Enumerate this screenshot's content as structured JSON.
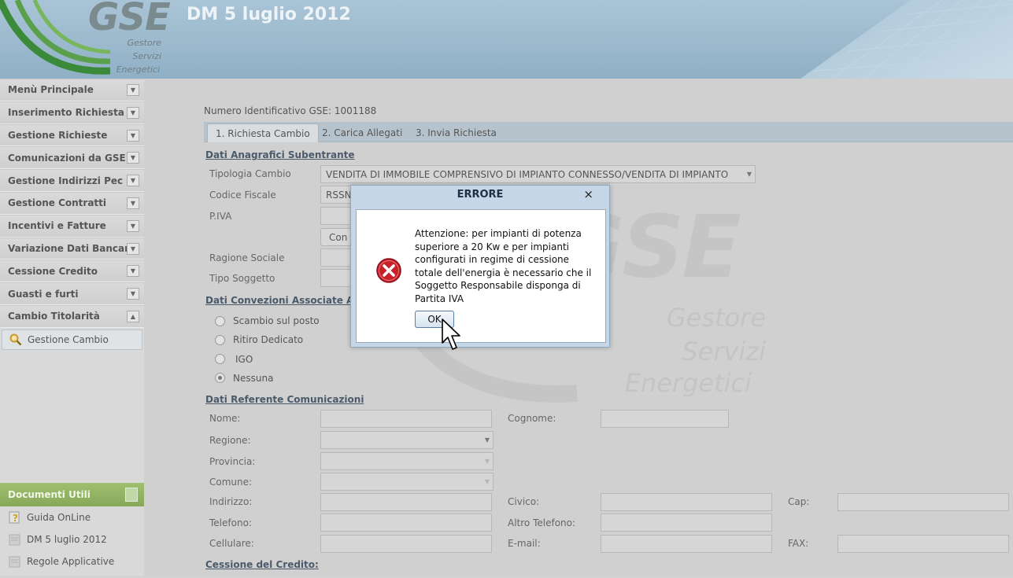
{
  "header": {
    "logo_text": "GSE",
    "logo_lines": [
      "Gestore",
      "Servizi",
      "Energetici"
    ],
    "app_title": "DM 5 luglio 2012"
  },
  "sidebar": {
    "items": [
      {
        "label": "Menù Principale",
        "toggle": "▼"
      },
      {
        "label": "Inserimento Richiesta",
        "toggle": "▼"
      },
      {
        "label": "Gestione Richieste",
        "toggle": "▼"
      },
      {
        "label": "Comunicazioni da GSE",
        "toggle": "▼"
      },
      {
        "label": "Gestione Indirizzi Pec",
        "toggle": "▼"
      },
      {
        "label": "Gestione Contratti",
        "toggle": "▼"
      },
      {
        "label": "Incentivi e Fatture",
        "toggle": "▼"
      },
      {
        "label": "Variazione Dati Bancari",
        "toggle": "▼"
      },
      {
        "label": "Cessione Credito",
        "toggle": "▼"
      },
      {
        "label": "Guasti e furti",
        "toggle": "▼"
      },
      {
        "label": "Cambio Titolarità",
        "toggle": "▲"
      }
    ],
    "subitem": {
      "label": "Gestione Cambio",
      "icon": "search-icon"
    },
    "documents": {
      "header": "Documenti Utili",
      "items": [
        {
          "label": "Guida OnLine",
          "icon": "help-document-icon"
        },
        {
          "label": "DM 5 luglio 2012",
          "icon": "document-icon"
        },
        {
          "label": "Regole Applicative",
          "icon": "document-icon"
        }
      ]
    }
  },
  "main": {
    "watermark": {
      "text": "GSE",
      "lines": [
        "Gestore",
        "Servizi",
        "Energetici"
      ]
    },
    "gse_id": "Numero Identificativo GSE: 1001188",
    "tabs": [
      "1. Richiesta Cambio",
      "2. Carica Allegati",
      "3. Invia Richiesta"
    ],
    "section_anagrafici": "Dati Anagrafici Subentrante",
    "tipologia_label": "Tipologia Cambio",
    "tipologia_value": "VENDITA DI IMMOBILE COMPRENSIVO DI IMPIANTO CONNESSO/VENDITA DI IMPIANTO",
    "codice_fiscale_label": "Codice Fiscale",
    "codice_fiscale_value": "RSSN",
    "piva_label": "P.IVA",
    "control_button": "Con",
    "ragione_sociale_label": "Ragione Sociale",
    "tipo_soggetto_label": "Tipo Soggetto",
    "section_convenzioni": "Dati Convezioni Associate All' in",
    "radios": [
      {
        "label": "Scambio sul posto",
        "checked": false
      },
      {
        "label": "Ritiro Dedicato",
        "checked": false
      },
      {
        "label": "IGO",
        "checked": false
      },
      {
        "label": "Nessuna",
        "checked": true
      }
    ],
    "section_referente": "Dati Referente Comunicazioni",
    "labels": {
      "nome": "Nome:",
      "cognome": "Cognome:",
      "regione": "Regione:",
      "provincia": "Provincia:",
      "comune": "Comune:",
      "indirizzo": "Indirizzo:",
      "civico": "Civico:",
      "cap": "Cap:",
      "telefono": "Telefono:",
      "altro_telefono": "Altro Telefono:",
      "cellulare": "Cellulare:",
      "email": "E-mail:",
      "fax": "FAX:"
    },
    "section_cessione": "Cessione del Credito:"
  },
  "modal": {
    "title": "ERRORE",
    "close": "×",
    "message": "Attenzione: per impianti di potenza superiore a 20 Kw e per impianti configurati in regime di cessione totale dell'energia è necessario che il Soggetto Responsabile disponga di Partita IVA",
    "ok_label": "OK"
  },
  "colors": {
    "header": "#9bb8cc",
    "sidebar": "#d9d9d9",
    "doc_header": "#86a858",
    "error_red": "#c8202a"
  }
}
